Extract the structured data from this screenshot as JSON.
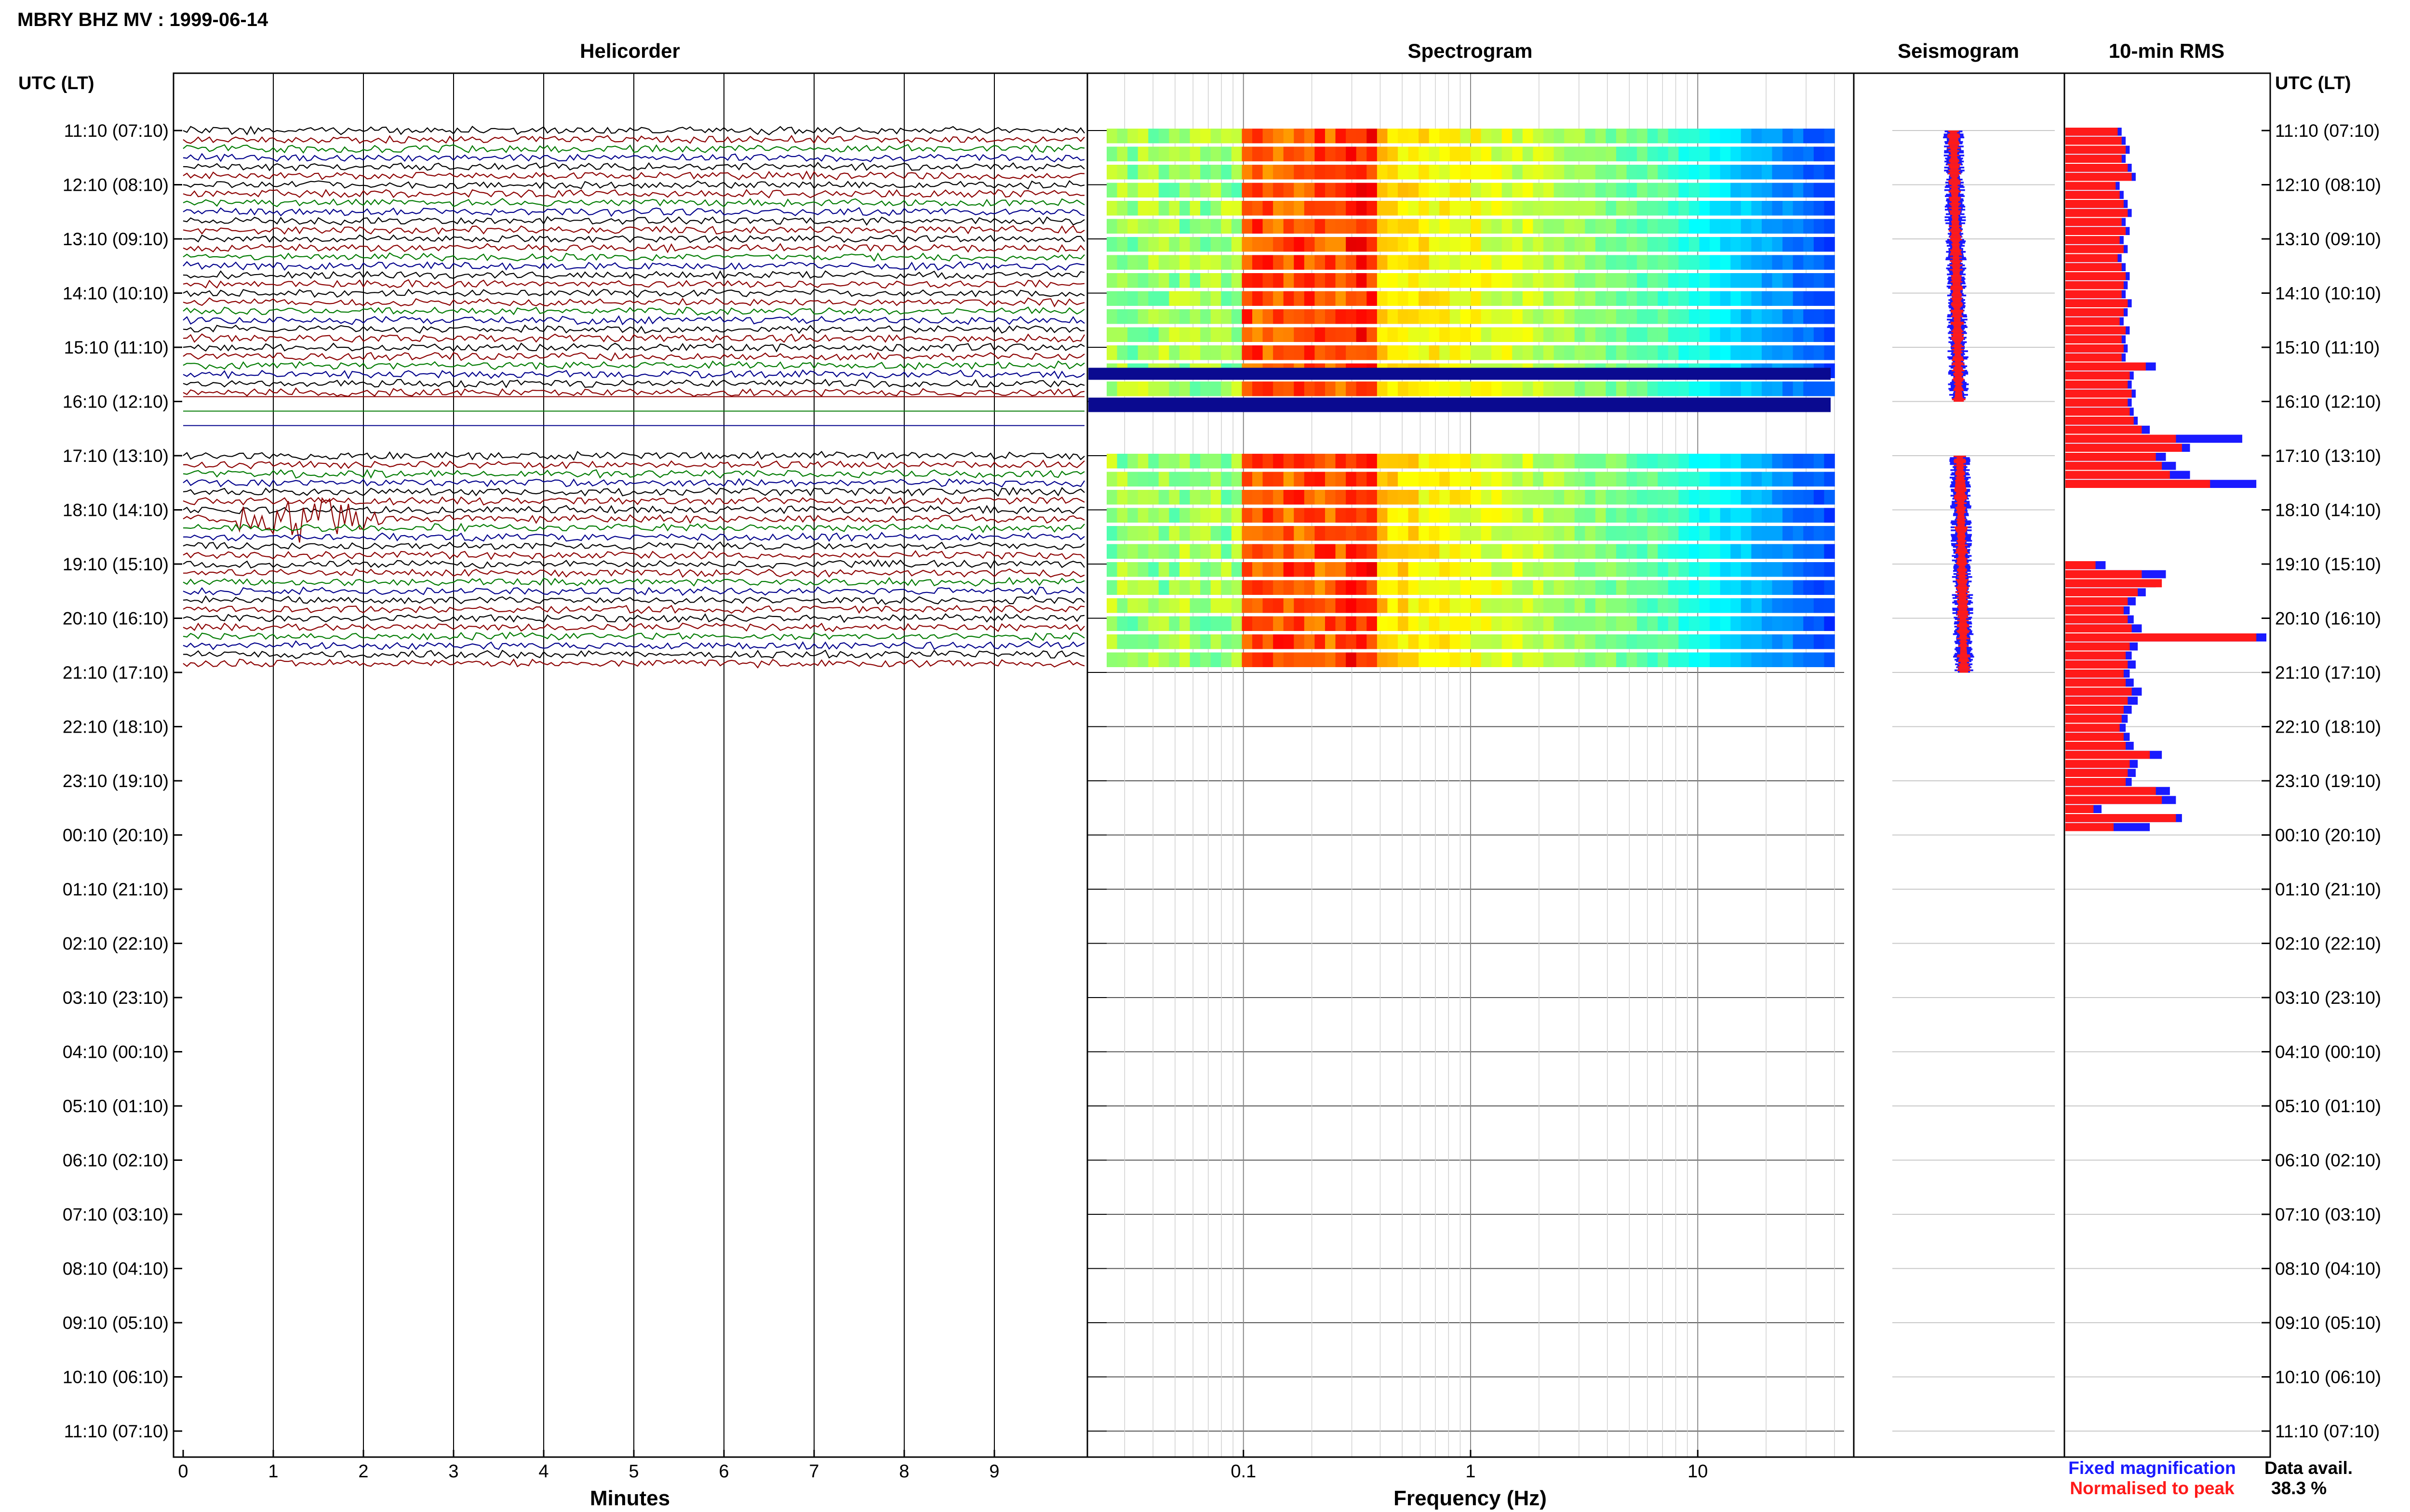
{
  "header": {
    "title": "MBRY BHZ MV : 1999-06-14"
  },
  "panels": {
    "helicorder": "Helicorder",
    "spectrogram": "Spectrogram",
    "seismogram": "Seismogram",
    "rms": "10-min RMS"
  },
  "axis_titles": {
    "left": "UTC (LT)",
    "right": "UTC (LT)",
    "minutes": "Minutes",
    "frequency": "Frequency (Hz)"
  },
  "legend": {
    "fixed": "Fixed magnification",
    "normalised": "Normalised to peak",
    "fixed_color": "#1a1aff",
    "normalised_color": "#ff1a1a"
  },
  "data_avail": {
    "label": "Data avail.",
    "value": "38.3 %"
  },
  "trace_colors": [
    "#000000",
    "#8b0000",
    "#007a00",
    "#00008b"
  ],
  "chart_data": {
    "type": "heatmap",
    "time_labels": [
      "11:10 (07:10)",
      "12:10 (08:10)",
      "13:10 (09:10)",
      "14:10 (10:10)",
      "15:10 (11:10)",
      "16:10 (12:10)",
      "17:10 (13:10)",
      "18:10 (14:10)",
      "19:10 (15:10)",
      "20:10 (16:10)",
      "21:10 (17:10)",
      "22:10 (18:10)",
      "23:10 (19:10)",
      "00:10 (20:10)",
      "01:10 (21:10)",
      "02:10 (22:10)",
      "03:10 (23:10)",
      "04:10 (00:10)",
      "05:10 (01:10)",
      "06:10 (02:10)",
      "07:10 (03:10)",
      "08:10 (04:10)",
      "09:10 (05:10)",
      "10:10 (06:10)",
      "11:10 (07:10)"
    ],
    "minutes_ticks": [
      "0",
      "1",
      "2",
      "3",
      "4",
      "5",
      "6",
      "7",
      "8",
      "9"
    ],
    "minutes_range": [
      0,
      10
    ],
    "frequency_ticks": [
      "0.1",
      "1",
      "10"
    ],
    "frequency_range_hz": [
      0.025,
      40
    ],
    "frequency_scale": "log",
    "hours_with_data": 10,
    "gap_hours": [
      5
    ],
    "events": [
      {
        "hour": 7,
        "minute": 1.3,
        "description": "large event"
      }
    ],
    "rms_per_10min": {
      "fixed": [
        0.28,
        0.3,
        0.32,
        0.3,
        0.33,
        0.35,
        0.27,
        0.29,
        0.31,
        0.33,
        0.3,
        0.32,
        0.29,
        0.31,
        0.28,
        0.3,
        0.32,
        0.31,
        0.3,
        0.33,
        0.31,
        0.29,
        0.32,
        0.3,
        0.31,
        0.3,
        0.45,
        0.34,
        0.33,
        0.35,
        0.33,
        0.34,
        0.36,
        0.42,
        0.88,
        0.62,
        0.5,
        0.55,
        0.62,
        0.95,
        null,
        null,
        null,
        null,
        null,
        null,
        null,
        null,
        0.2,
        0.5,
        0.45,
        0.4,
        0.35,
        0.32,
        0.34,
        0.38,
        1.0,
        0.36,
        0.33,
        0.35,
        0.32,
        0.34,
        0.38,
        0.36,
        0.33,
        0.31,
        0.3,
        0.32,
        0.34,
        0.48,
        0.36,
        0.35,
        0.33,
        0.52,
        0.55,
        0.18,
        0.58,
        0.42
      ],
      "normalised": [
        0.26,
        0.28,
        0.3,
        0.28,
        0.31,
        0.33,
        0.25,
        0.27,
        0.29,
        0.31,
        0.28,
        0.3,
        0.27,
        0.29,
        0.26,
        0.28,
        0.3,
        0.29,
        0.28,
        0.31,
        0.29,
        0.27,
        0.3,
        0.28,
        0.29,
        0.28,
        0.4,
        0.32,
        0.31,
        0.33,
        0.31,
        0.32,
        0.34,
        0.38,
        0.55,
        0.58,
        0.45,
        0.48,
        0.52,
        0.72,
        null,
        null,
        null,
        null,
        null,
        null,
        null,
        null,
        0.15,
        0.38,
        0.48,
        0.36,
        0.31,
        0.29,
        0.31,
        0.33,
        0.95,
        0.32,
        0.3,
        0.31,
        0.29,
        0.3,
        0.33,
        0.31,
        0.29,
        0.28,
        0.27,
        0.29,
        0.3,
        0.42,
        0.32,
        0.31,
        0.3,
        0.45,
        0.48,
        0.14,
        0.55,
        0.24
      ]
    }
  }
}
